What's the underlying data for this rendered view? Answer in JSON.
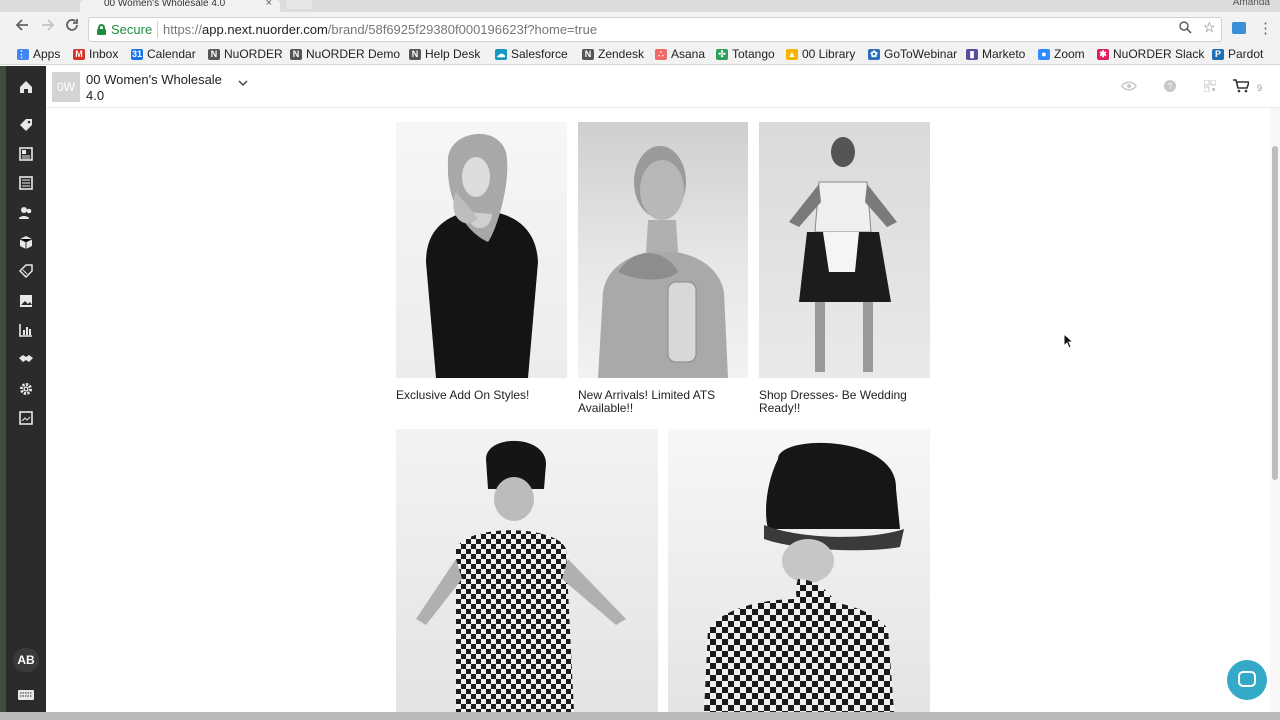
{
  "browser": {
    "tab_title": "00 Women's Wholesale 4.0",
    "tab_close": "×",
    "profile": "Amanda",
    "secure_label": "Secure",
    "url_scheme": "https://",
    "url_host": "app.next.nuorder.com",
    "url_path": "/brand/58f6925f29380f000196623f?home=true",
    "bookmarks": [
      {
        "label": "Apps",
        "icon": "apps-grid-icon",
        "color": "#4285f4",
        "glyph": "⋮⋮"
      },
      {
        "label": "Inbox",
        "icon": "gmail-icon",
        "color": "#d93025",
        "glyph": "M"
      },
      {
        "label": "Calendar",
        "icon": "calendar-icon",
        "color": "#1a73e8",
        "glyph": "31"
      },
      {
        "label": "NuORDER",
        "icon": "nuorder-icon",
        "color": "#555555",
        "glyph": "N"
      },
      {
        "label": "NuORDER Demo",
        "icon": "nuorder-demo-icon",
        "color": "#555555",
        "glyph": "N"
      },
      {
        "label": "Help Desk",
        "icon": "helpdesk-icon",
        "color": "#555555",
        "glyph": "N"
      },
      {
        "label": "Salesforce",
        "icon": "salesforce-icon",
        "color": "#1798c1",
        "glyph": "☁"
      },
      {
        "label": "Zendesk",
        "icon": "zendesk-icon",
        "color": "#555555",
        "glyph": "N"
      },
      {
        "label": "Asana",
        "icon": "asana-icon",
        "color": "#f06a6a",
        "glyph": "∴"
      },
      {
        "label": "Totango",
        "icon": "totango-icon",
        "color": "#2e9e5b",
        "glyph": "✣"
      },
      {
        "label": "00 Library",
        "icon": "google-drive-icon",
        "color": "#f4b400",
        "glyph": "▲"
      },
      {
        "label": "GoToWebinar",
        "icon": "gotowebinar-icon",
        "color": "#2a6ebb",
        "glyph": "✿"
      },
      {
        "label": "Marketo",
        "icon": "marketo-icon",
        "color": "#5c4c9f",
        "glyph": "▮"
      },
      {
        "label": "Zoom",
        "icon": "zoom-icon",
        "color": "#2d8cff",
        "glyph": "●"
      },
      {
        "label": "NuORDER Slack",
        "icon": "slack-icon",
        "color": "#e01e5a",
        "glyph": "✱"
      },
      {
        "label": "Pardot",
        "icon": "pardot-icon",
        "color": "#1f6fb5",
        "glyph": "P"
      }
    ]
  },
  "app": {
    "brand_initials": "0W",
    "brand_name": "00 Women's Wholesale 4.0",
    "cart_count": "9",
    "user_initials": "AB"
  },
  "sidebar_icons": [
    "home-icon",
    "tag-icon",
    "catalog-icon",
    "linesheet-icon",
    "customers-icon",
    "orders-box-icon",
    "promotions-icon",
    "media-icon",
    "reports-icon",
    "handshake-icon",
    "settings-gear-icon",
    "image-editor-icon"
  ],
  "cards": [
    {
      "caption": "Exclusive Add On Styles!"
    },
    {
      "caption": "New Arrivals! Limited ATS Available!!"
    },
    {
      "caption": "Shop Dresses- Be Wedding Ready!!"
    },
    {
      "caption": ""
    },
    {
      "caption": ""
    }
  ],
  "colors": {
    "sidebar": "#2b2b2b",
    "secure_green": "#1e8e3e",
    "chat_button": "#35a9c8"
  }
}
